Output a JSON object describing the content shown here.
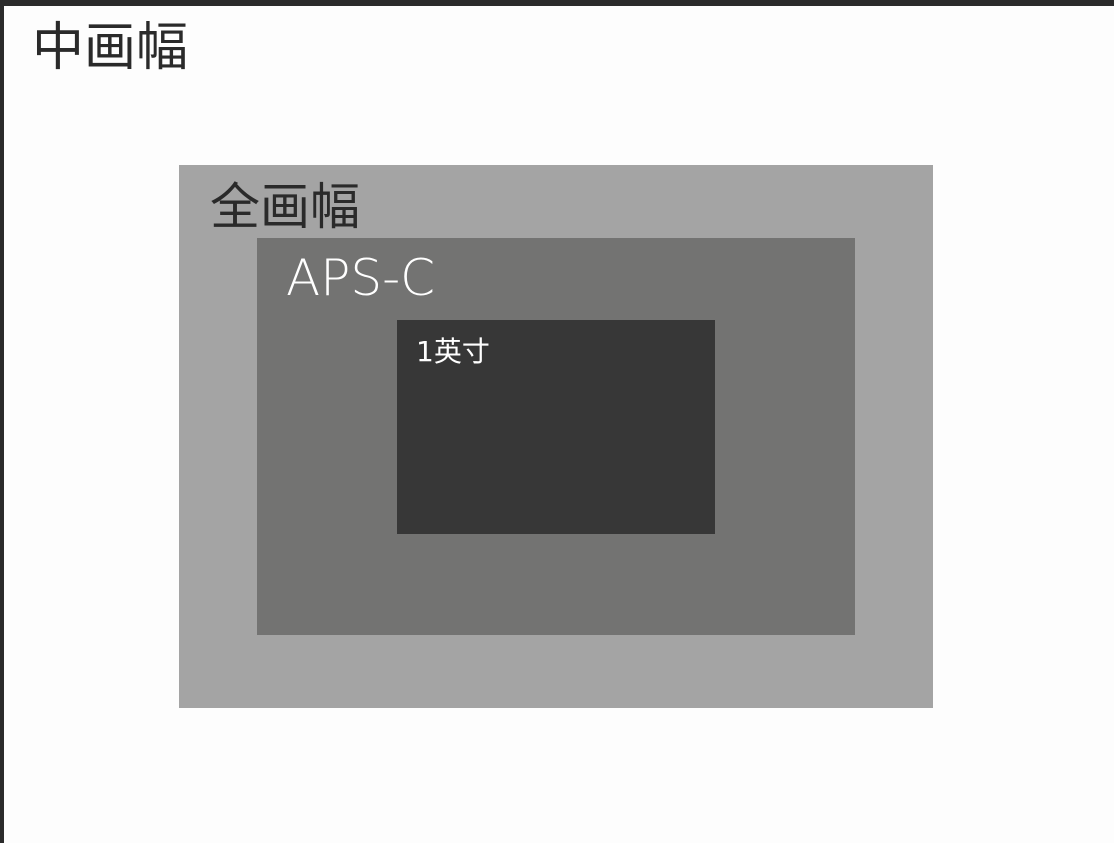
{
  "diagram": {
    "canvas_label": "中画幅",
    "sensors": {
      "full_frame": {
        "label": "全画幅",
        "fill": "#a4a4a4"
      },
      "aps_c": {
        "label": "APS-C",
        "fill": "#737372"
      },
      "one_inch": {
        "label": "1英寸",
        "fill": "#373737"
      }
    }
  },
  "colors": {
    "background": "#fdfdfd",
    "frame": "#2b2b2b"
  }
}
